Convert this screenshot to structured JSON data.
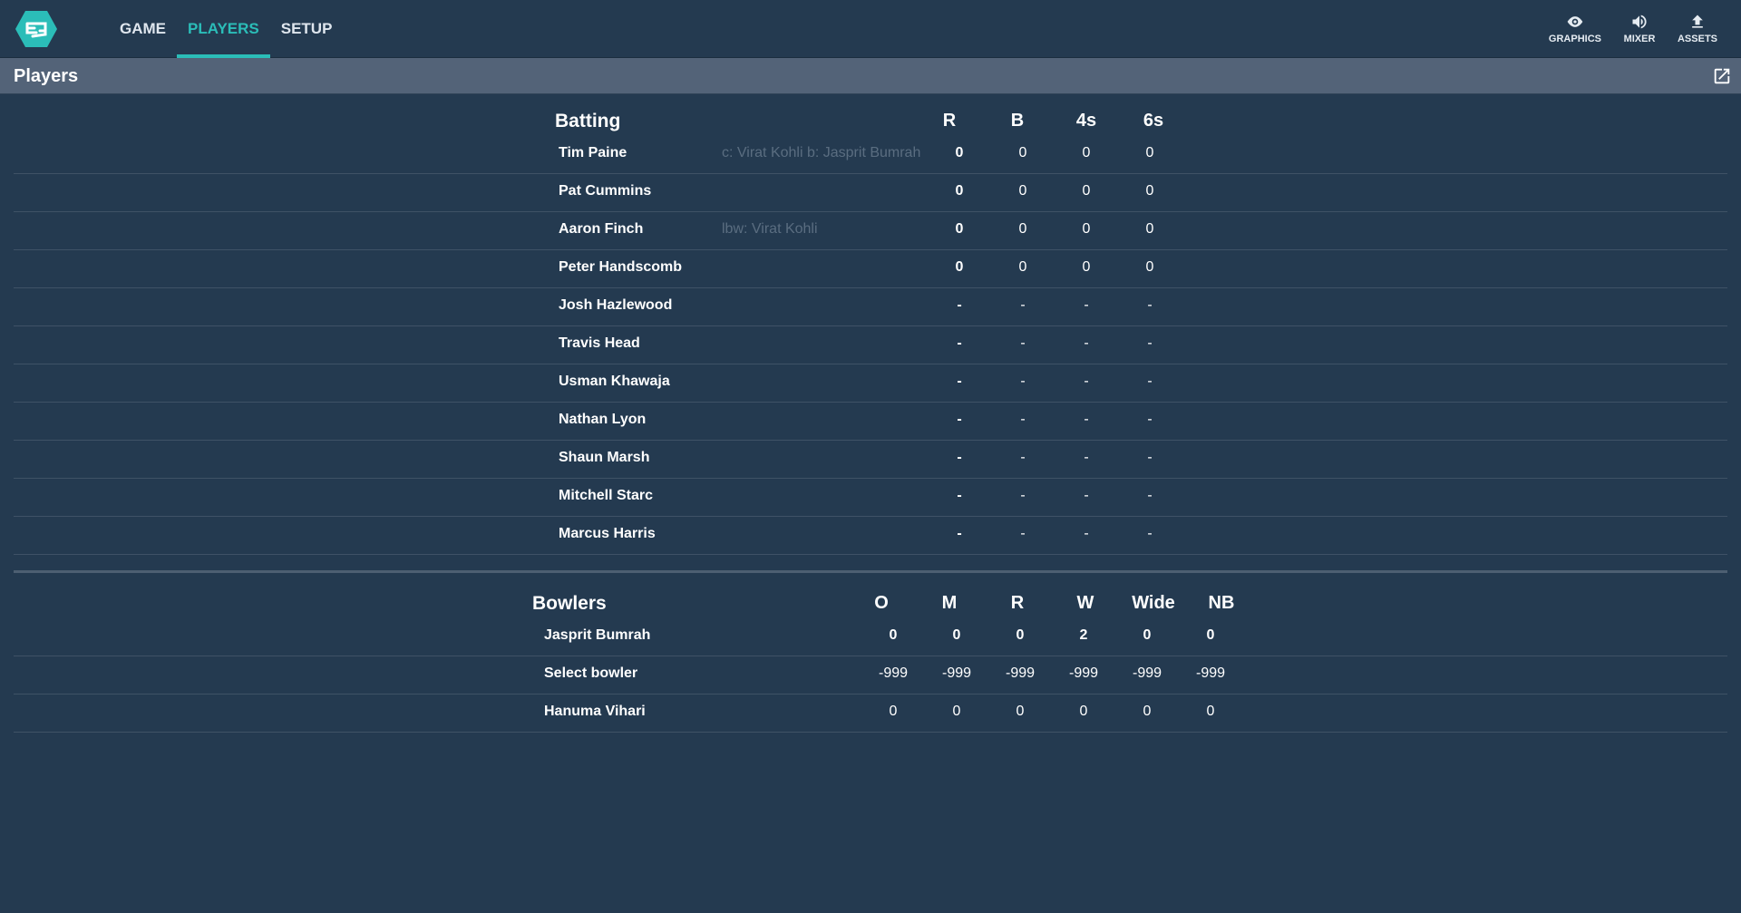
{
  "nav": {
    "tabs": [
      {
        "label": "GAME",
        "active": false
      },
      {
        "label": "PLAYERS",
        "active": true
      },
      {
        "label": "SETUP",
        "active": false
      }
    ]
  },
  "tools": [
    {
      "label": "GRAPHICS",
      "icon": "eye-icon"
    },
    {
      "label": "MIXER",
      "icon": "volume-icon"
    },
    {
      "label": "ASSETS",
      "icon": "upload-icon"
    }
  ],
  "panel": {
    "title": "Players",
    "popout_icon": "open-in-new-icon"
  },
  "batting": {
    "title": "Batting",
    "columns": [
      "R",
      "B",
      "4s",
      "6s"
    ],
    "rows": [
      {
        "name": "Tim Paine",
        "dismissal": "c: Virat Kohli b: Jasprit Bumrah",
        "r": "0",
        "b": "0",
        "fours": "0",
        "sixes": "0"
      },
      {
        "name": "Pat Cummins",
        "dismissal": "",
        "r": "0",
        "b": "0",
        "fours": "0",
        "sixes": "0"
      },
      {
        "name": "Aaron Finch",
        "dismissal": "lbw: Virat Kohli",
        "r": "0",
        "b": "0",
        "fours": "0",
        "sixes": "0"
      },
      {
        "name": "Peter Handscomb",
        "dismissal": "",
        "r": "0",
        "b": "0",
        "fours": "0",
        "sixes": "0"
      },
      {
        "name": "Josh Hazlewood",
        "dismissal": "",
        "r": "-",
        "b": "-",
        "fours": "-",
        "sixes": "-"
      },
      {
        "name": "Travis Head",
        "dismissal": "",
        "r": "-",
        "b": "-",
        "fours": "-",
        "sixes": "-"
      },
      {
        "name": "Usman Khawaja",
        "dismissal": "",
        "r": "-",
        "b": "-",
        "fours": "-",
        "sixes": "-"
      },
      {
        "name": "Nathan Lyon",
        "dismissal": "",
        "r": "-",
        "b": "-",
        "fours": "-",
        "sixes": "-"
      },
      {
        "name": "Shaun Marsh",
        "dismissal": "",
        "r": "-",
        "b": "-",
        "fours": "-",
        "sixes": "-"
      },
      {
        "name": "Mitchell Starc",
        "dismissal": "",
        "r": "-",
        "b": "-",
        "fours": "-",
        "sixes": "-"
      },
      {
        "name": "Marcus Harris",
        "dismissal": "",
        "r": "-",
        "b": "-",
        "fours": "-",
        "sixes": "-"
      }
    ]
  },
  "bowling": {
    "title": "Bowlers",
    "columns": [
      "O",
      "M",
      "R",
      "W",
      "Wide",
      "NB"
    ],
    "rows": [
      {
        "name": "Jasprit Bumrah",
        "values": [
          "0",
          "0",
          "0",
          "2",
          "0",
          "0"
        ],
        "bold": true
      },
      {
        "name": "Select bowler",
        "values": [
          "-999",
          "-999",
          "-999",
          "-999",
          "-999",
          "-999"
        ],
        "bold": false
      },
      {
        "name": "Hanuma Vihari",
        "values": [
          "0",
          "0",
          "0",
          "0",
          "0",
          "0"
        ],
        "bold": false
      }
    ]
  },
  "colors": {
    "accent": "#2bbdb8",
    "background": "#243a50",
    "header_bar": "#536378",
    "dismissal_text": "#5a6d80"
  }
}
